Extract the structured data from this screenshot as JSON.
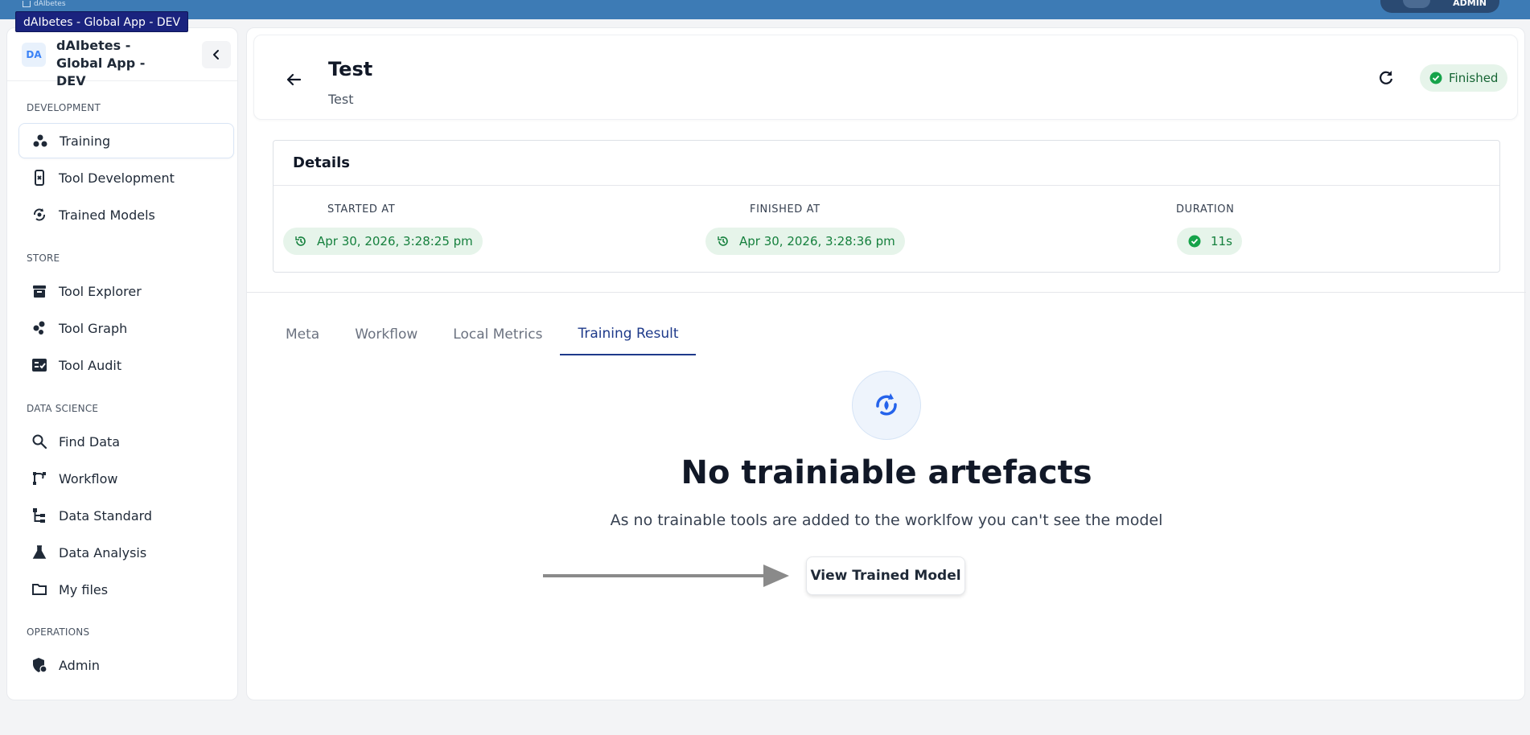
{
  "topbar": {
    "logo_text": "dAIbetes",
    "account_label": "ADMIN"
  },
  "tooltip": "dAIbetes - Global App - DEV",
  "sidebar": {
    "avatar": "DA",
    "title": "dAIbetes - Global App - DEV",
    "sections": [
      {
        "label": "DEVELOPMENT",
        "items": [
          {
            "label": "Training",
            "icon": "training-icon",
            "active": true
          },
          {
            "label": "Tool Development",
            "icon": "tool-development-icon"
          },
          {
            "label": "Trained Models",
            "icon": "trained-models-icon"
          }
        ]
      },
      {
        "label": "STORE",
        "items": [
          {
            "label": "Tool Explorer",
            "icon": "archive-icon"
          },
          {
            "label": "Tool Graph",
            "icon": "graph-icon"
          },
          {
            "label": "Tool Audit",
            "icon": "audit-icon"
          }
        ]
      },
      {
        "label": "DATA SCIENCE",
        "items": [
          {
            "label": "Find Data",
            "icon": "search-icon"
          },
          {
            "label": "Workflow",
            "icon": "workflow-icon"
          },
          {
            "label": "Data Standard",
            "icon": "data-standard-icon"
          },
          {
            "label": "Data Analysis",
            "icon": "flask-icon"
          },
          {
            "label": "My files",
            "icon": "folder-icon"
          }
        ]
      },
      {
        "label": "OPERATIONS",
        "items": [
          {
            "label": "Admin",
            "icon": "admin-shield-icon"
          }
        ]
      }
    ]
  },
  "header": {
    "title": "Test",
    "subtitle": "Test",
    "status": "Finished",
    "status_color": "#166534"
  },
  "details": {
    "heading": "Details",
    "started_label": "STARTED AT",
    "started_value": "Apr 30, 2026, 3:28:25 pm",
    "finished_label": "FINISHED AT",
    "finished_value": "Apr 30, 2026, 3:28:36 pm",
    "duration_label": "DURATION",
    "duration_value": "11s"
  },
  "tabs": [
    "Meta",
    "Workflow",
    "Local Metrics",
    "Training Result"
  ],
  "active_tab": "Training Result",
  "empty_state": {
    "title": "No trainiable artefacts",
    "description": "As no trainable tools are added to the worklfow you can't see the model",
    "button": "View Trained Model"
  },
  "colors": {
    "accent": "#1e3a8a",
    "success_bg": "#e6f4ea",
    "success_text": "#15803d",
    "topbar": "#3d7bb5"
  }
}
